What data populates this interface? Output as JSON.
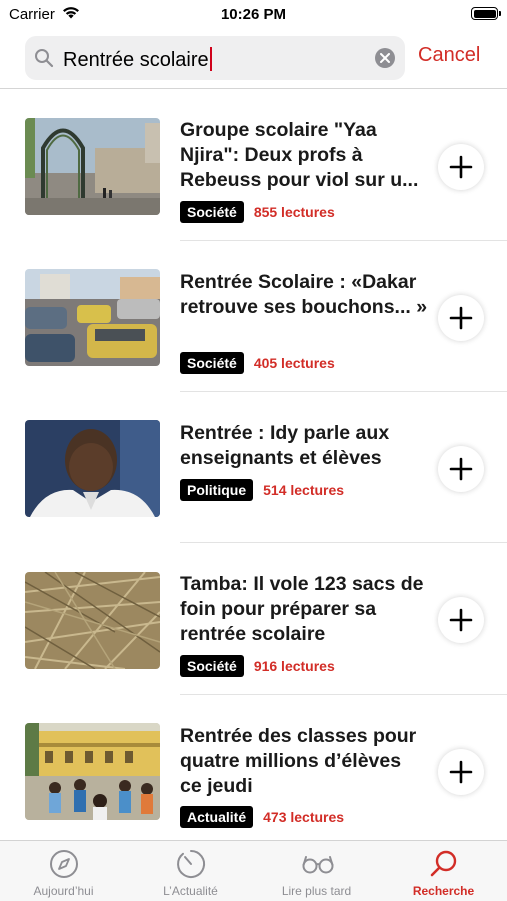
{
  "status_bar": {
    "carrier": "Carrier",
    "time": "10:26 PM"
  },
  "search": {
    "query": "Rentrée scolaire",
    "cancel_label": "Cancel"
  },
  "colors": {
    "accent": "#d22d27",
    "badge_bg": "#000000"
  },
  "results": [
    {
      "title": "Groupe scolaire \"Yaa Njira\": Deux profs à Rebeuss pour viol sur u...",
      "category": "Société",
      "reads": "855 lectures",
      "thumbnail": "gate-street-photo"
    },
    {
      "title": "Rentrée Scolaire : «Dakar retrouve ses bouchons... »",
      "category": "Société",
      "reads": "405 lectures",
      "thumbnail": "traffic-taxis-photo"
    },
    {
      "title": "Rentrée : Idy parle aux enseignants et élèves",
      "category": "Politique",
      "reads": "514 lectures",
      "thumbnail": "portrait-photo"
    },
    {
      "title": "Tamba: Il vole 123 sacs de foin pour préparer sa rentrée scolaire",
      "category": "Société",
      "reads": "916 lectures",
      "thumbnail": "hay-photo"
    },
    {
      "title": "Rentrée des classes pour quatre millions d’élèves ce jeudi",
      "category": "Actualité",
      "reads": "473 lectures",
      "thumbnail": "school-children-photo"
    }
  ],
  "tabs": [
    {
      "label": "Aujourd’hui",
      "icon": "compass-icon",
      "active": false
    },
    {
      "label": "L’Actualité",
      "icon": "clock-icon",
      "active": false
    },
    {
      "label": "Lire plus tard",
      "icon": "glasses-icon",
      "active": false
    },
    {
      "label": "Recherche",
      "icon": "search-icon",
      "active": true
    }
  ]
}
